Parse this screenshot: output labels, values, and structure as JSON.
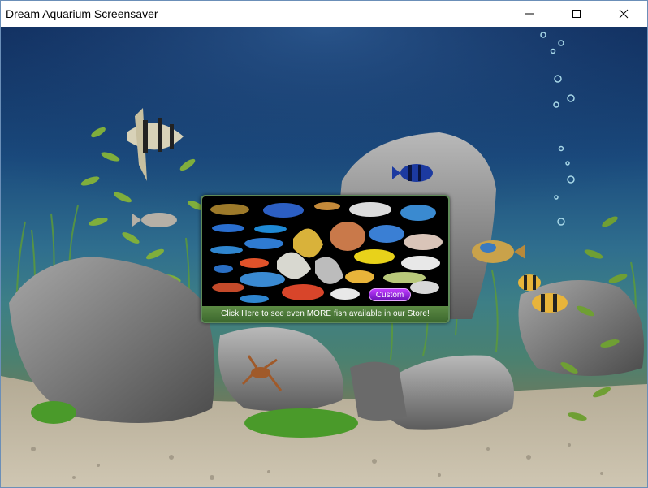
{
  "window": {
    "title": "Dream Aquarium Screensaver"
  },
  "controls": {
    "minimize_icon": "minimize-icon",
    "maximize_icon": "maximize-icon",
    "close_icon": "close-icon"
  },
  "store_panel": {
    "custom_label": "Custom",
    "footer_text": "Click Here to see even MORE fish available in our Store!"
  },
  "colors": {
    "water_top": "#0f2c5c",
    "panel_border": "#5f8a58",
    "custom_button": "#a020f0"
  }
}
